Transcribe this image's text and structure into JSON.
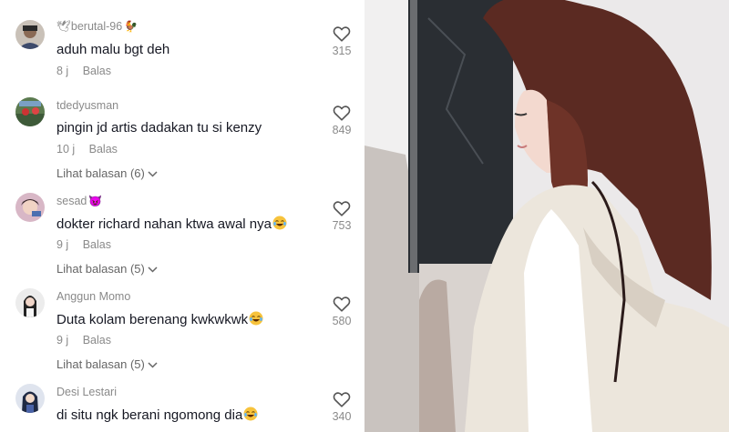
{
  "comments": [
    {
      "username": "berutal-96",
      "username_prefix_emoji": "🕊",
      "username_suffix_emoji": "🐓",
      "text": "aduh malu bgt deh",
      "text_emoji": "",
      "time": "8 j",
      "reply_label": "Balas",
      "likes": "315",
      "replies_label": ""
    },
    {
      "username": "tdedyusman",
      "username_prefix_emoji": "",
      "username_suffix_emoji": "",
      "text": "pingin jd artis dadakan tu si kenzy",
      "text_emoji": "",
      "time": "10 j",
      "reply_label": "Balas",
      "likes": "849",
      "replies_label": "Lihat balasan (6)"
    },
    {
      "username": "sesad",
      "username_prefix_emoji": "",
      "username_suffix_emoji": "😈",
      "text": "dokter richard nahan ktwa awal nya",
      "text_emoji": "laugh-emoji",
      "time": "9 j",
      "reply_label": "Balas",
      "likes": "753",
      "replies_label": "Lihat balasan (5)"
    },
    {
      "username": "Anggun Momo",
      "username_prefix_emoji": "",
      "username_suffix_emoji": "",
      "text": "Duta kolam berenang kwkwkwk",
      "text_emoji": "laugh-emoji",
      "time": "9 j",
      "reply_label": "Balas",
      "likes": "580",
      "replies_label": "Lihat balasan (5)"
    },
    {
      "username": "Desi Lestari",
      "username_prefix_emoji": "",
      "username_suffix_emoji": "",
      "text": "di situ ngk berani ngomong dia",
      "text_emoji": "laugh-emoji",
      "time": "",
      "reply_label": "",
      "likes": "340",
      "replies_label": ""
    }
  ],
  "icons": {
    "like": "heart-outline-icon",
    "expand": "chevron-down-icon"
  },
  "colors": {
    "username": "#8a8a8a",
    "text": "#161823",
    "meta": "#8a8a8a"
  }
}
